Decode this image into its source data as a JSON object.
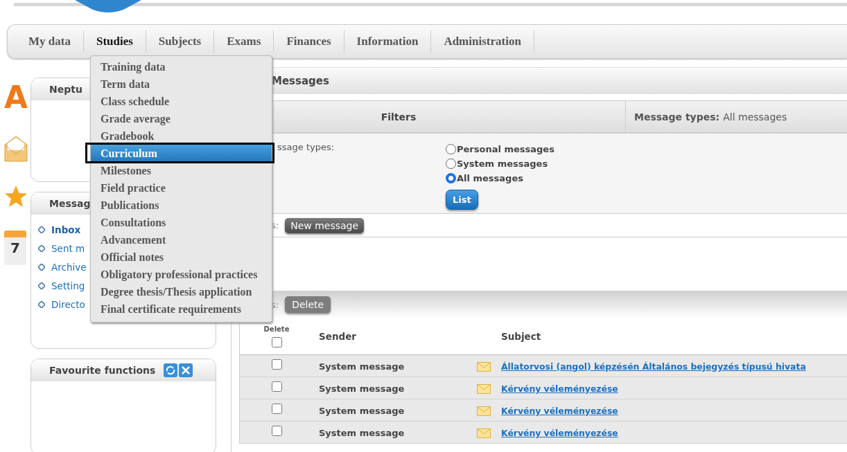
{
  "nav": {
    "tabs": [
      {
        "label": "My data",
        "selected": false
      },
      {
        "label": "Studies",
        "selected": true
      },
      {
        "label": "Subjects",
        "selected": false
      },
      {
        "label": "Exams",
        "selected": false
      },
      {
        "label": "Finances",
        "selected": false
      },
      {
        "label": "Information",
        "selected": false
      },
      {
        "label": "Administration",
        "selected": false
      }
    ]
  },
  "dropdown": {
    "items": [
      {
        "label": "Training data",
        "selected": false
      },
      {
        "label": "Term data",
        "selected": false
      },
      {
        "label": "Class schedule",
        "selected": false
      },
      {
        "label": "Grade average",
        "selected": false
      },
      {
        "label": "Gradebook",
        "selected": false
      },
      {
        "label": "Curriculum",
        "selected": true
      },
      {
        "label": "Milestones",
        "selected": false
      },
      {
        "label": "Field practice",
        "selected": false
      },
      {
        "label": "Publications",
        "selected": false
      },
      {
        "label": "Consultations",
        "selected": false
      },
      {
        "label": "Advancement",
        "selected": false
      },
      {
        "label": "Official notes",
        "selected": false
      },
      {
        "label": "Obligatory professional practices",
        "selected": false
      },
      {
        "label": "Degree thesis/Thesis application",
        "selected": false
      },
      {
        "label": "Final certificate requirements",
        "selected": false
      }
    ]
  },
  "side_icons": [
    {
      "kind": "letter",
      "char": "A"
    },
    {
      "kind": "envelope"
    },
    {
      "kind": "star"
    },
    {
      "kind": "calendar",
      "day": "7"
    }
  ],
  "neptun_panel": {
    "title": "Neptu"
  },
  "messages_panel": {
    "title": "Messag",
    "links": [
      {
        "label": "Inbox",
        "selected": true
      },
      {
        "label": "Sent m",
        "selected": false
      },
      {
        "label": "Archive",
        "selected": false
      },
      {
        "label": "Setting",
        "selected": false
      },
      {
        "label": "Directo",
        "selected": false
      }
    ]
  },
  "favourites_panel": {
    "title": "Favourite functions"
  },
  "content": {
    "title": "Messages",
    "filters": {
      "title": "Filters",
      "summary_label": "Message types:",
      "summary_value": "All messages",
      "field_label": "ssage types:",
      "options": [
        {
          "label": "Personal messages",
          "selected": false
        },
        {
          "label": "System messages",
          "selected": false
        },
        {
          "label": "All messages",
          "selected": true
        }
      ],
      "button": "List"
    },
    "new_row": {
      "label": "s:",
      "button": "New message"
    },
    "delete_row": {
      "label": "s:",
      "button": "Delete"
    },
    "table": {
      "columns": [
        "Delete",
        "Sender",
        "Subject"
      ],
      "header_checked": false,
      "rows": [
        {
          "checked": false,
          "sender": "System message",
          "subject": "Állatorvosi (angol) képzésén Általános bejegyzés típusú hivata"
        },
        {
          "checked": false,
          "sender": "System message",
          "subject": "Kérvény véleményezése"
        },
        {
          "checked": false,
          "sender": "System message",
          "subject": "Kérvény véleményezése"
        },
        {
          "checked": false,
          "sender": "System message",
          "subject": "Kérvény véleményezése"
        }
      ]
    }
  }
}
